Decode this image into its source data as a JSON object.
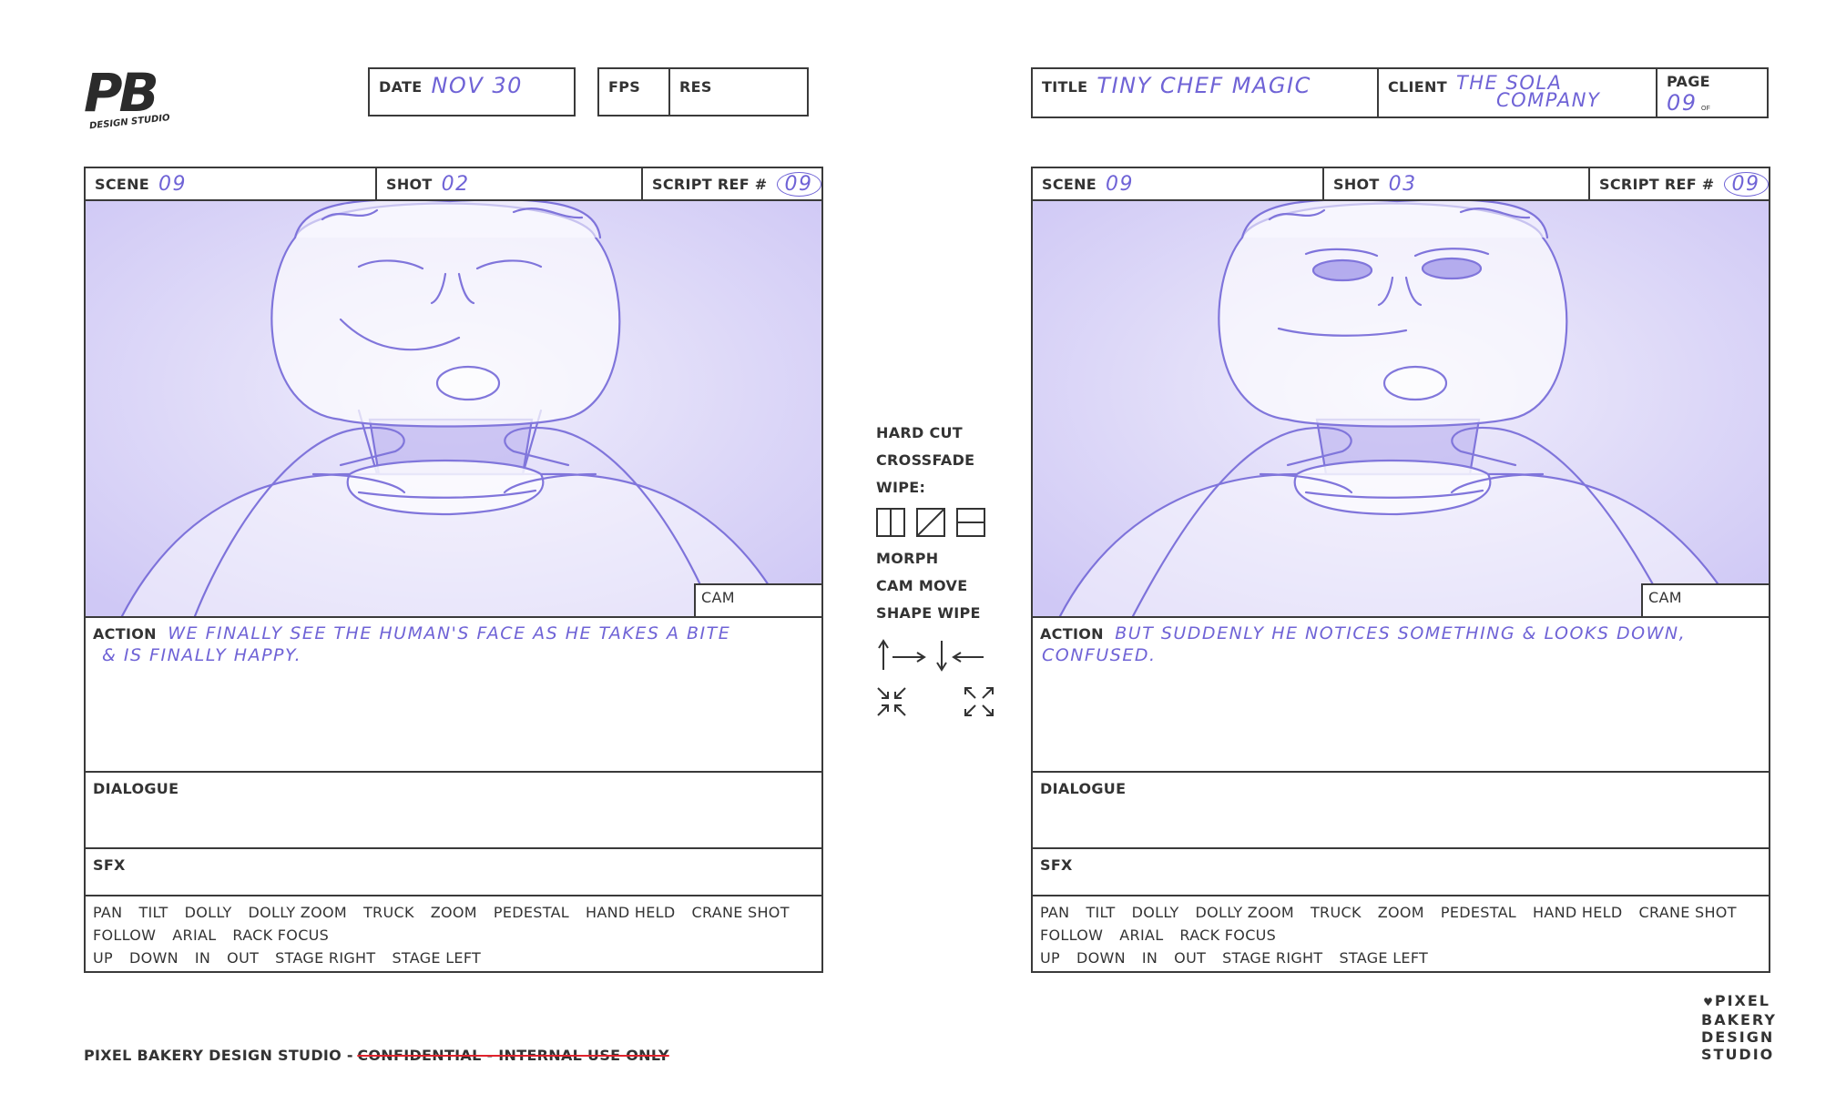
{
  "header_left": {
    "logo_text": "PB",
    "logo_sub": "DESIGN STUDIO",
    "date_label": "DATE",
    "date_value": "NOV 30",
    "fps_label": "FPS",
    "res_label": "RES"
  },
  "header_right": {
    "title_label": "TITLE",
    "title_value": "TINY CHEF MAGIC",
    "client_label": "CLIENT",
    "client_value_1": "THE SOLA",
    "client_value_2": "COMPANY",
    "page_label": "PAGE",
    "page_value": "09",
    "page_of": "OF"
  },
  "panels": [
    {
      "scene_label": "SCENE",
      "scene_value": "09",
      "shot_label": "SHOT",
      "shot_value": "02",
      "ref_label": "SCRIPT REF #",
      "ref_value": "09",
      "cam_label": "CAM",
      "action_label": "ACTION",
      "action_line_1": "WE FINALLY SEE THE HUMAN'S FACE AS HE TAKES A BITE",
      "action_line_2": "& IS FINALLY HAPPY.",
      "dialogue_label": "DIALOGUE",
      "sfx_label": "SFX"
    },
    {
      "scene_label": "SCENE",
      "scene_value": "09",
      "shot_label": "SHOT",
      "shot_value": "03",
      "ref_label": "SCRIPT REF #",
      "ref_value": "09",
      "cam_label": "CAM",
      "action_label": "ACTION",
      "action_line_1": "BUT SUDDENLY HE NOTICES SOMETHING & LOOKS DOWN,",
      "action_line_2": "CONFUSED.",
      "dialogue_label": "DIALOGUE",
      "sfx_label": "SFX"
    }
  ],
  "camera_moves": {
    "line1": [
      "PAN",
      "TILT",
      "DOLLY",
      "DOLLY ZOOM",
      "TRUCK",
      "ZOOM",
      "PEDESTAL",
      "HAND HELD",
      "CRANE SHOT"
    ],
    "line2": [
      "FOLLOW",
      "ARIAL",
      "RACK FOCUS"
    ],
    "line3": [
      "UP",
      "DOWN",
      "IN",
      "OUT",
      "STAGE RIGHT",
      "STAGE LEFT"
    ]
  },
  "transitions": {
    "hard_cut": "HARD CUT",
    "crossfade": "CROSSFADE",
    "wipe": "WIPE:",
    "morph": "MORPH",
    "cam_move": "CAM MOVE",
    "shape_wipe": "SHAPE WIPE"
  },
  "footer": {
    "studio": "PIXEL BAKERY DESIGN STUDIO -",
    "confidential": "CONFIDENTIAL - INTERNAL USE ONLY",
    "logo_lines": [
      "PIXEL",
      "BAKERY",
      "DESIGN",
      "STUDIO"
    ]
  },
  "colors": {
    "pencil": "#6f63d6",
    "ink": "#3a3a3a",
    "strike": "#e0232d"
  }
}
